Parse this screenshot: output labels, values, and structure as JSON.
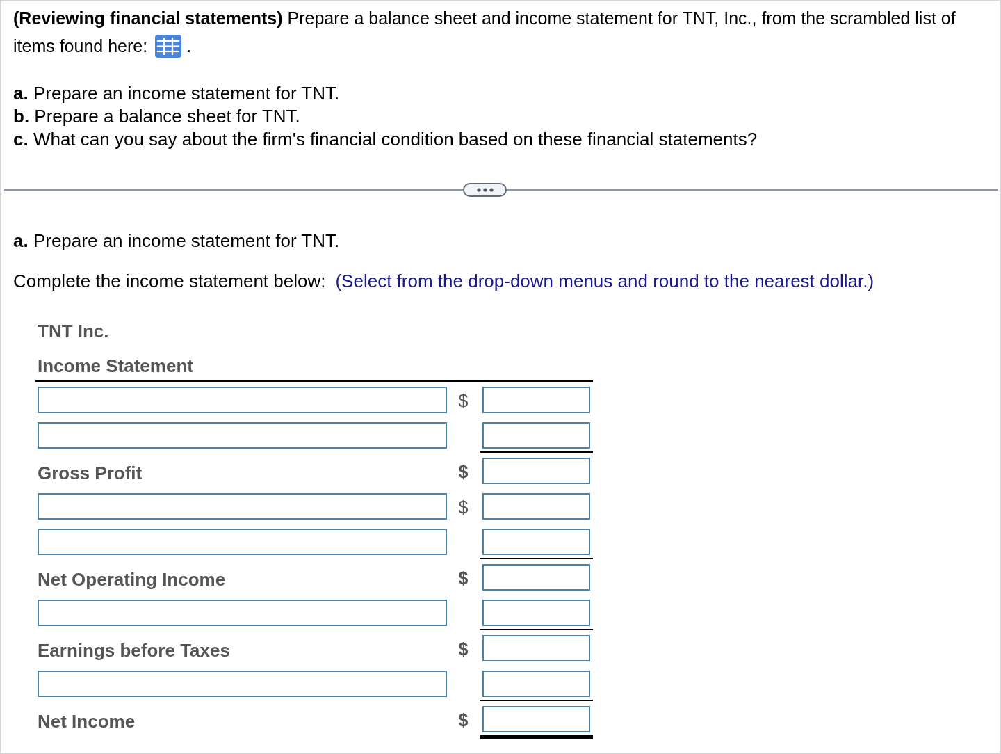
{
  "question": {
    "intro_lines": [
      "**(Reviewing financial statements)** Prepare a balance sheet and income statement for TNT, Inc., from the scrambled list of",
      "items found here:"
    ],
    "intro_end": ".",
    "parts": [
      "**a.** Prepare an income statement for TNT.",
      "**b.** Prepare a balance sheet for TNT.",
      "**c.** What can you say about the firm's financial condition based on these financial statements?"
    ]
  },
  "part_a": {
    "heading": "**a.** Prepare an income statement for TNT.",
    "instruction": "Complete the income statement below:",
    "hint": "(Select from the drop-down menus and round to the nearest dollar.)"
  },
  "statement": {
    "company": "TNT Inc.",
    "title": "Income Statement",
    "rows": [
      {
        "kind": "entry",
        "currency": "$"
      },
      {
        "kind": "entry",
        "underlined": true
      },
      {
        "kind": "total",
        "label": "Gross Profit",
        "currency": "$"
      },
      {
        "kind": "entry",
        "currency": "$"
      },
      {
        "kind": "entry",
        "underlined": true
      },
      {
        "kind": "total",
        "label": "Net Operating Income",
        "currency": "$"
      },
      {
        "kind": "entry",
        "underlined": true
      },
      {
        "kind": "total",
        "label": "Earnings before Taxes",
        "currency": "$"
      },
      {
        "kind": "entry",
        "underlined": true
      },
      {
        "kind": "total",
        "label": "Net Income",
        "currency": "$",
        "double_underlined": true
      }
    ]
  }
}
